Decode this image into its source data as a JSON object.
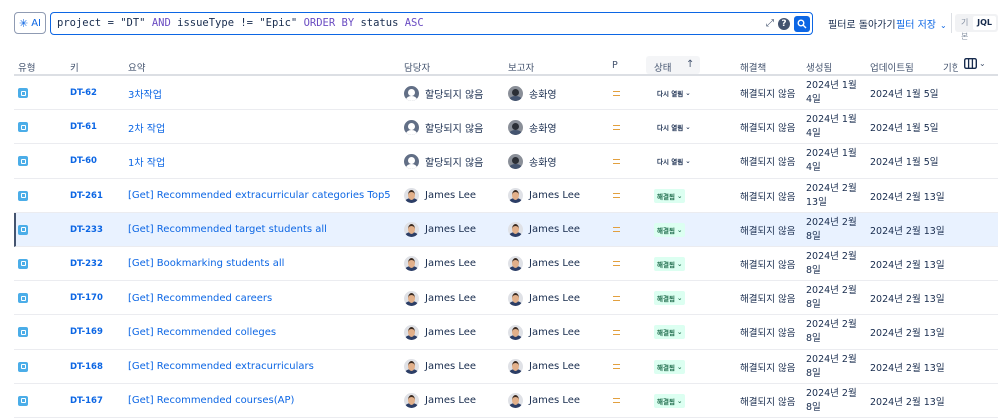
{
  "topbar": {
    "ai_label": "AI",
    "query": {
      "p1": "project = \"DT\" ",
      "k1": "AND",
      "p2": " issueType != \"Epic\" ",
      "k2": "ORDER BY",
      "p3": " status ",
      "k3": "ASC"
    },
    "filter_back": "필터로 돌아가기",
    "filter_save": "필터 저장",
    "toggle_basic": "기본",
    "toggle_jql": "JQL"
  },
  "columns": {
    "type": "유형",
    "key": "키",
    "summary": "요약",
    "assignee": "담당자",
    "reporter": "보고자",
    "priority": "P",
    "status": "상태",
    "resolution": "해결책",
    "created": "생성됨",
    "updated": "업데이트됨",
    "due": "기한"
  },
  "accent_color": "#0c66e4",
  "rows": [
    {
      "key": "DT-62",
      "summary": "3차작업",
      "assignee": "할당되지 않음",
      "assignee_avatar": "unassigned",
      "reporter": "송화영",
      "reporter_avatar": "photo",
      "status": "다시 열림",
      "status_color": "grey",
      "resolution": "해결되지 않음",
      "created": "2024년 1월 4일",
      "updated": "2024년 1월 5일"
    },
    {
      "key": "DT-61",
      "summary": "2차 작업",
      "assignee": "할당되지 않음",
      "assignee_avatar": "unassigned",
      "reporter": "송화영",
      "reporter_avatar": "photo",
      "status": "다시 열림",
      "status_color": "grey",
      "resolution": "해결되지 않음",
      "created": "2024년 1월 4일",
      "updated": "2024년 1월 5일"
    },
    {
      "key": "DT-60",
      "summary": "1차 작업",
      "assignee": "할당되지 않음",
      "assignee_avatar": "unassigned",
      "reporter": "송화영",
      "reporter_avatar": "photo",
      "status": "다시 열림",
      "status_color": "grey",
      "resolution": "해결되지 않음",
      "created": "2024년 1월 4일",
      "updated": "2024년 1월 5일"
    },
    {
      "key": "DT-261",
      "summary": "[Get] Recommended extracurricular categories Top5",
      "assignee": "James Lee",
      "assignee_avatar": "james",
      "reporter": "James Lee",
      "reporter_avatar": "james",
      "status": "해결됨",
      "status_color": "green",
      "resolution": "해결되지 않음",
      "created": "2024년 2월 13일",
      "updated": "2024년 2월 13일"
    },
    {
      "key": "DT-233",
      "summary": "[Get] Recommended target students all",
      "assignee": "James Lee",
      "assignee_avatar": "james",
      "reporter": "James Lee",
      "reporter_avatar": "james",
      "status": "해결됨",
      "status_color": "green",
      "resolution": "해결되지 않음",
      "created": "2024년 2월 8일",
      "updated": "2024년 2월 13일"
    },
    {
      "key": "DT-232",
      "summary": "[Get] Bookmarking students all",
      "assignee": "James Lee",
      "assignee_avatar": "james",
      "reporter": "James Lee",
      "reporter_avatar": "james",
      "status": "해결됨",
      "status_color": "green",
      "resolution": "해결되지 않음",
      "created": "2024년 2월 8일",
      "updated": "2024년 2월 13일"
    },
    {
      "key": "DT-170",
      "summary": "[Get] Recommended careers",
      "assignee": "James Lee",
      "assignee_avatar": "james",
      "reporter": "James Lee",
      "reporter_avatar": "james",
      "status": "해결됨",
      "status_color": "green",
      "resolution": "해결되지 않음",
      "created": "2024년 2월 8일",
      "updated": "2024년 2월 13일"
    },
    {
      "key": "DT-169",
      "summary": "[Get] Recommended colleges",
      "assignee": "James Lee",
      "assignee_avatar": "james",
      "reporter": "James Lee",
      "reporter_avatar": "james",
      "status": "해결됨",
      "status_color": "green",
      "resolution": "해결되지 않음",
      "created": "2024년 2월 8일",
      "updated": "2024년 2월 13일"
    },
    {
      "key": "DT-168",
      "summary": "[Get] Recommended extracurriculars",
      "assignee": "James Lee",
      "assignee_avatar": "james",
      "reporter": "James Lee",
      "reporter_avatar": "james",
      "status": "해결됨",
      "status_color": "green",
      "resolution": "해결되지 않음",
      "created": "2024년 2월 8일",
      "updated": "2024년 2월 13일"
    },
    {
      "key": "DT-167",
      "summary": "[Get] Recommended courses(AP)",
      "assignee": "James Lee",
      "assignee_avatar": "james",
      "reporter": "James Lee",
      "reporter_avatar": "james",
      "status": "해결됨",
      "status_color": "green",
      "resolution": "해결되지 않음",
      "created": "2024년 2월 8일",
      "updated": "2024년 2월 13일"
    }
  ]
}
